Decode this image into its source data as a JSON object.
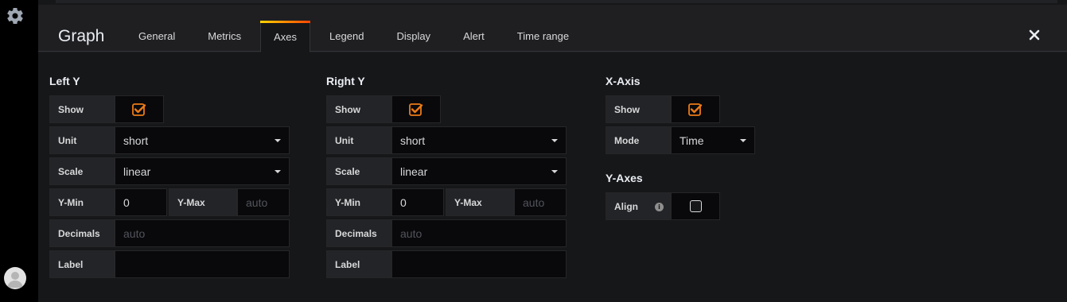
{
  "panel": {
    "title": "Graph",
    "tabs": [
      {
        "label": "General"
      },
      {
        "label": "Metrics"
      },
      {
        "label": "Axes"
      },
      {
        "label": "Legend"
      },
      {
        "label": "Display"
      },
      {
        "label": "Alert"
      },
      {
        "label": "Time range"
      }
    ],
    "active_tab": "Axes"
  },
  "left_y": {
    "title": "Left Y",
    "show_label": "Show",
    "show_checked": true,
    "unit_label": "Unit",
    "unit_value": "short",
    "scale_label": "Scale",
    "scale_value": "linear",
    "ymin_label": "Y-Min",
    "ymin_value": "0",
    "ymax_label": "Y-Max",
    "ymax_placeholder": "auto",
    "decimals_label": "Decimals",
    "decimals_placeholder": "auto",
    "label_label": "Label",
    "label_value": ""
  },
  "right_y": {
    "title": "Right Y",
    "show_label": "Show",
    "show_checked": true,
    "unit_label": "Unit",
    "unit_value": "short",
    "scale_label": "Scale",
    "scale_value": "linear",
    "ymin_label": "Y-Min",
    "ymin_value": "0",
    "ymax_label": "Y-Max",
    "ymax_placeholder": "auto",
    "decimals_label": "Decimals",
    "decimals_placeholder": "auto",
    "label_label": "Label",
    "label_value": ""
  },
  "x_axis": {
    "title": "X-Axis",
    "show_label": "Show",
    "show_checked": true,
    "mode_label": "Mode",
    "mode_value": "Time"
  },
  "y_axes": {
    "title": "Y-Axes",
    "align_label": "Align",
    "align_checked": false
  },
  "colors": {
    "accent": "#eb7b18",
    "background": "#161719",
    "editor": "#1f1f22"
  }
}
